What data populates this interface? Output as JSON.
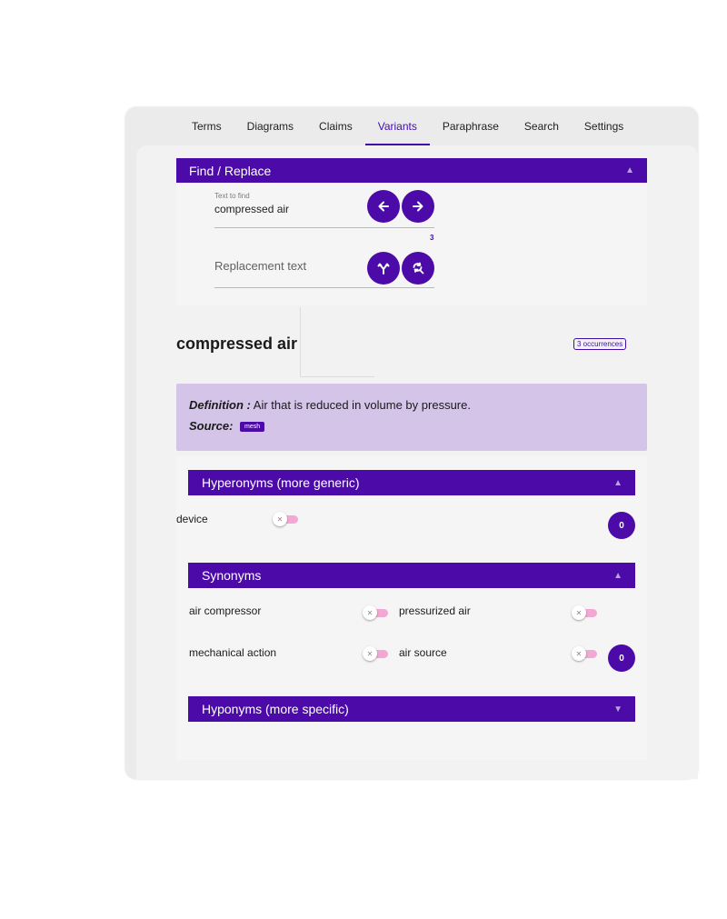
{
  "tabs": [
    {
      "label": "Terms"
    },
    {
      "label": "Diagrams"
    },
    {
      "label": "Claims"
    },
    {
      "label": "Variants",
      "active": true
    },
    {
      "label": "Paraphrase"
    },
    {
      "label": "Search"
    },
    {
      "label": "Settings"
    }
  ],
  "find_replace": {
    "title": "Find / Replace",
    "find_label": "Text to find",
    "find_value": "compressed air",
    "match_count": "3",
    "replace_placeholder": "Replacement text",
    "icons": {
      "prev": "arrow-left-icon",
      "next": "arrow-right-icon",
      "replace": "replace-fork-icon",
      "replace_all": "search-replace-icon"
    }
  },
  "term": {
    "title": "compressed air",
    "occurrences": "3 occurrences",
    "definition_label": "Definition :",
    "definition_text": "Air that is reduced in volume by pressure.",
    "source_label": "Source:",
    "source_chip": "mesh"
  },
  "hyperonyms": {
    "title": "Hyperonyms (more generic)",
    "items": [
      "device"
    ],
    "count": "0"
  },
  "synonyms": {
    "title": "Synonyms",
    "items": [
      "air compressor",
      "pressurized air",
      "mechanical action",
      "air source"
    ],
    "count": "0"
  },
  "hyponyms": {
    "title": "Hyponyms (more specific)"
  },
  "colors": {
    "accent": "#4c0aa9",
    "definition_bg": "#d3c4e8",
    "toggle_track": "#f3a8d4"
  }
}
